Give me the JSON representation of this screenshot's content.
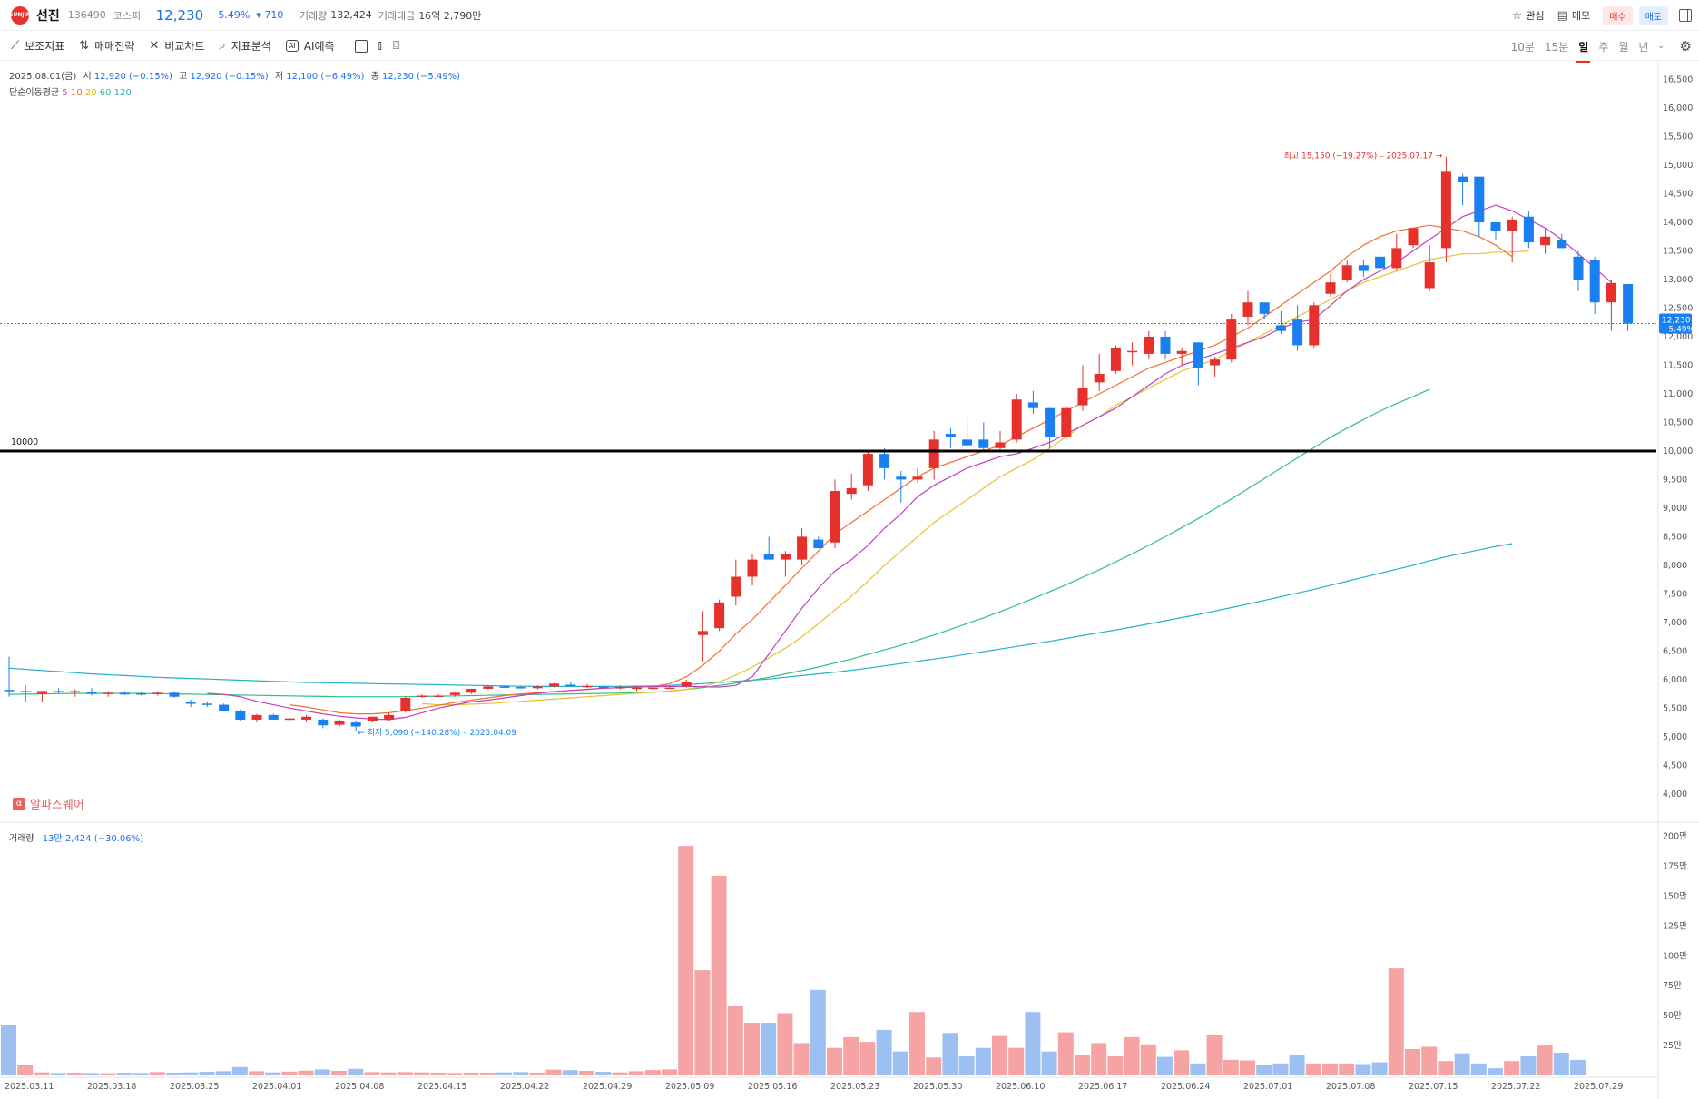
{
  "header": {
    "logo_text": "SUNJIN",
    "name": "선진",
    "code": "136490",
    "market": "코스피",
    "price": "12,230",
    "change_pct": "−5.49%",
    "change_amt": "▾ 710",
    "volume_label": "거래량",
    "volume": "132,424",
    "amount_label": "거래대금",
    "amount": "16억 2,790만",
    "watch_label": "관심",
    "memo_label": "메모",
    "buy_label": "매수",
    "sell_label": "매도"
  },
  "toolbar": {
    "indicators": "보조지표",
    "strategy": "매매전략",
    "compare": "비교차트",
    "analysis": "지표분석",
    "ai_badge": "AI",
    "ai_predict": "AI예측",
    "periods": [
      "10분",
      "15분",
      "일",
      "주",
      "월",
      "년"
    ],
    "active_period": "일"
  },
  "info": {
    "date": "2025.08.01(금)",
    "open_label": "시",
    "open": "12,920 (−0.15%)",
    "high_label": "고",
    "high": "12,920 (−0.15%)",
    "low_label": "저",
    "low": "12,100 (−6.49%)",
    "close_label": "종",
    "close": "12,230 (−5.49%)",
    "ma_label": "단순이동평균",
    "ma_periods": [
      "5",
      "10",
      "20",
      "60",
      "120"
    ],
    "volume_label": "거래량",
    "volume_value": "13만 2,424 (−30.06%)",
    "watermark": "알파스퀘어",
    "watermark_icon": "α"
  },
  "colors": {
    "up": "#e5302c",
    "down": "#1a7ff0",
    "vol_up": "#f5a3a3",
    "vol_down": "#9cc0f2",
    "vol_neutral": "#b5b5b5",
    "ma5": "#c040c0",
    "ma10": "#f07030",
    "ma20": "#e8c030",
    "ma60": "#2ec27a",
    "ma120": "#26b0c8"
  },
  "chart_data": {
    "type": "candlestick",
    "y_ticks": [
      4000,
      4500,
      5000,
      5500,
      6000,
      6500,
      7000,
      7500,
      8000,
      8500,
      9000,
      9500,
      10000,
      10500,
      11000,
      11500,
      12000,
      12500,
      13000,
      13500,
      14000,
      14500,
      15000,
      15500,
      16000,
      16500
    ],
    "ylim": [
      3600,
      16700
    ],
    "volume_ticks": [
      "25만",
      "50만",
      "75만",
      "100만",
      "125만",
      "150만",
      "175만",
      "200만"
    ],
    "volume_tick_values": [
      250000,
      500000,
      750000,
      1000000,
      1250000,
      1500000,
      1750000,
      2000000
    ],
    "volume_ylim": [
      0,
      2050000
    ],
    "x_tick_labels": [
      "2025.03.11",
      "2025.03.18",
      "2025.03.25",
      "2025.04.01",
      "2025.04.08",
      "2025.04.15",
      "2025.04.22",
      "2025.04.29",
      "2025.05.09",
      "2025.05.16",
      "2025.05.23",
      "2025.05.30",
      "2025.06.10",
      "2025.06.17",
      "2025.06.24",
      "2025.07.01",
      "2025.07.08",
      "2025.07.15",
      "2025.07.22",
      "2025.07.29"
    ],
    "x_tick_indices": [
      0,
      5,
      10,
      15,
      20,
      25,
      30,
      35,
      40,
      45,
      50,
      55,
      60,
      65,
      70,
      75,
      80,
      85,
      90,
      95
    ],
    "candles": [
      [
        5820,
        6400,
        5700,
        5800
      ],
      [
        5800,
        5900,
        5600,
        5800
      ],
      [
        5750,
        5800,
        5600,
        5800
      ],
      [
        5800,
        5850,
        5750,
        5780
      ],
      [
        5780,
        5830,
        5700,
        5800
      ],
      [
        5780,
        5850,
        5720,
        5750
      ],
      [
        5760,
        5800,
        5700,
        5770
      ],
      [
        5770,
        5800,
        5730,
        5740
      ],
      [
        5760,
        5790,
        5720,
        5740
      ],
      [
        5750,
        5800,
        5720,
        5770
      ],
      [
        5770,
        5800,
        5680,
        5700
      ],
      [
        5600,
        5650,
        5520,
        5580
      ],
      [
        5580,
        5620,
        5520,
        5560
      ],
      [
        5560,
        5580,
        5450,
        5450
      ],
      [
        5450,
        5480,
        5280,
        5300
      ],
      [
        5300,
        5400,
        5250,
        5380
      ],
      [
        5380,
        5400,
        5300,
        5300
      ],
      [
        5300,
        5350,
        5250,
        5320
      ],
      [
        5300,
        5380,
        5250,
        5350
      ],
      [
        5300,
        5320,
        5150,
        5200
      ],
      [
        5210,
        5300,
        5170,
        5270
      ],
      [
        5250,
        5280,
        5090,
        5180
      ],
      [
        5280,
        5350,
        5250,
        5350
      ],
      [
        5300,
        5420,
        5280,
        5380
      ],
      [
        5450,
        5700,
        5420,
        5680
      ],
      [
        5700,
        5740,
        5680,
        5720
      ],
      [
        5710,
        5740,
        5690,
        5720
      ],
      [
        5730,
        5780,
        5700,
        5770
      ],
      [
        5770,
        5840,
        5750,
        5840
      ],
      [
        5840,
        5900,
        5830,
        5880
      ],
      [
        5880,
        5900,
        5850,
        5860
      ],
      [
        5870,
        5890,
        5850,
        5860
      ],
      [
        5850,
        5900,
        5830,
        5880
      ],
      [
        5880,
        5940,
        5860,
        5930
      ],
      [
        5910,
        5950,
        5880,
        5900
      ],
      [
        5880,
        5920,
        5850,
        5890
      ],
      [
        5880,
        5910,
        5840,
        5860
      ],
      [
        5860,
        5900,
        5830,
        5870
      ],
      [
        5860,
        5890,
        5800,
        5860
      ],
      [
        5860,
        5880,
        5830,
        5860
      ],
      [
        5860,
        5890,
        5840,
        5860
      ],
      [
        5880,
        6000,
        5860,
        5960
      ],
      [
        6780,
        7200,
        6300,
        6850
      ],
      [
        6900,
        7400,
        6850,
        7350
      ],
      [
        7450,
        8100,
        7300,
        7800
      ],
      [
        7800,
        8200,
        7650,
        8100
      ],
      [
        8200,
        8500,
        8100,
        8100
      ],
      [
        8100,
        8250,
        7800,
        8200
      ],
      [
        8100,
        8650,
        8000,
        8500
      ],
      [
        8450,
        8500,
        8300,
        8300
      ],
      [
        8400,
        9500,
        8300,
        9300
      ],
      [
        9250,
        9600,
        9150,
        9350
      ],
      [
        9400,
        10000,
        9300,
        9950
      ],
      [
        9950,
        10050,
        9500,
        9700
      ],
      [
        9550,
        9650,
        9100,
        9500
      ],
      [
        9500,
        9700,
        9450,
        9550
      ],
      [
        9700,
        10350,
        9500,
        10200
      ],
      [
        10300,
        10400,
        10050,
        10250
      ],
      [
        10200,
        10600,
        10000,
        10100
      ],
      [
        10200,
        10500,
        10000,
        10050
      ],
      [
        10050,
        10350,
        10000,
        10150
      ],
      [
        10200,
        11000,
        10150,
        10900
      ],
      [
        10850,
        11050,
        10650,
        10750
      ],
      [
        10750,
        10750,
        10050,
        10250
      ],
      [
        10250,
        10800,
        10200,
        10750
      ],
      [
        10800,
        11500,
        10700,
        11100
      ],
      [
        11200,
        11700,
        11050,
        11350
      ],
      [
        11400,
        11850,
        11350,
        11800
      ],
      [
        11750,
        11900,
        11500,
        11750
      ],
      [
        11700,
        12100,
        11600,
        12000
      ],
      [
        12000,
        12100,
        11600,
        11700
      ],
      [
        11700,
        11800,
        11500,
        11750
      ],
      [
        11900,
        11900,
        11150,
        11450
      ],
      [
        11500,
        11650,
        11300,
        11600
      ],
      [
        11600,
        12400,
        11550,
        12300
      ],
      [
        12350,
        12800,
        12200,
        12600
      ],
      [
        12600,
        12600,
        12300,
        12400
      ],
      [
        12200,
        12450,
        12050,
        12100
      ],
      [
        12300,
        12550,
        11750,
        11850
      ],
      [
        11850,
        12600,
        11800,
        12550
      ],
      [
        12750,
        13100,
        12700,
        12950
      ],
      [
        13000,
        13350,
        12950,
        13250
      ],
      [
        13250,
        13350,
        13050,
        13150
      ],
      [
        13400,
        13500,
        13200,
        13200
      ],
      [
        13200,
        13800,
        13150,
        13550
      ],
      [
        13600,
        13900,
        13550,
        13900
      ],
      [
        12850,
        13600,
        12800,
        13300
      ],
      [
        13550,
        15150,
        13300,
        14900
      ],
      [
        14800,
        14850,
        14300,
        14700
      ],
      [
        14800,
        14800,
        13750,
        14000
      ],
      [
        14000,
        14000,
        13700,
        13850
      ],
      [
        13850,
        14100,
        13300,
        14050
      ],
      [
        14100,
        14200,
        13550,
        13650
      ],
      [
        13600,
        13900,
        13450,
        13750
      ],
      [
        13700,
        13800,
        13550,
        13550
      ],
      [
        13400,
        13500,
        12800,
        13000
      ],
      [
        13350,
        13400,
        12400,
        12600
      ],
      [
        12600,
        13000,
        12100,
        12940
      ],
      [
        12920,
        12920,
        12100,
        12230
      ]
    ],
    "volumes": [
      420000,
      90000,
      25000,
      20000,
      22000,
      20000,
      18000,
      22000,
      20000,
      28000,
      22000,
      25000,
      30000,
      35000,
      70000,
      35000,
      25000,
      32000,
      40000,
      50000,
      38000,
      55000,
      28000,
      25000,
      28000,
      25000,
      22000,
      20000,
      22000,
      22000,
      25000,
      28000,
      22000,
      48000,
      44000,
      38000,
      30000,
      25000,
      35000,
      45000,
      50000,
      1920000,
      880000,
      1670000,
      585000,
      440000,
      440000,
      520000,
      270000,
      715000,
      230000,
      320000,
      280000,
      380000,
      200000,
      530000,
      150000,
      355000,
      160000,
      230000,
      330000,
      230000,
      530000,
      200000,
      360000,
      170000,
      270000,
      160000,
      320000,
      260000,
      155000,
      210000,
      100000,
      340000,
      130000,
      125000,
      90000,
      100000,
      170000,
      100000,
      100000,
      100000,
      95000,
      110000,
      895000,
      220000,
      240000,
      120000,
      185000,
      100000,
      60000,
      120000,
      160000,
      250000,
      190000,
      130000
    ],
    "ma_lines": {
      "ma5": {
        "start": 12,
        "values": [
          5760,
          5740,
          5700,
          5620,
          5560,
          5500,
          5450,
          5400,
          5360,
          5330,
          5310,
          5300,
          5340,
          5420,
          5500,
          5560,
          5610,
          5640,
          5680,
          5720,
          5760,
          5790,
          5810,
          5830,
          5850,
          5860,
          5870,
          5875,
          5880,
          5880,
          5875,
          5870,
          5900,
          6050,
          6450,
          6850,
          7250,
          7600,
          7900,
          8100,
          8350,
          8650,
          8900,
          9200,
          9400,
          9550,
          9700,
          9800,
          9900,
          9950,
          10050,
          10150,
          10300,
          10450,
          10600,
          10750,
          10950,
          11150,
          11350,
          11500,
          11600,
          11700,
          11800,
          11900,
          12000,
          12150,
          12250,
          12300,
          12550,
          12800,
          13000,
          13150,
          13300,
          13500,
          13700,
          13900,
          14100,
          14200,
          14300,
          14200,
          14050,
          13900,
          13700,
          13450,
          13200,
          12950
        ]
      },
      "ma10": {
        "start": 17,
        "values": [
          5560,
          5520,
          5470,
          5420,
          5400,
          5400,
          5420,
          5460,
          5500,
          5550,
          5600,
          5640,
          5680,
          5720,
          5750,
          5770,
          5790,
          5810,
          5830,
          5850,
          5860,
          5870,
          5880,
          5930,
          6050,
          6250,
          6500,
          6800,
          7050,
          7350,
          7650,
          7950,
          8250,
          8550,
          8750,
          8950,
          9150,
          9350,
          9550,
          9700,
          9800,
          9900,
          10000,
          10100,
          10250,
          10400,
          10550,
          10700,
          10850,
          11000,
          11150,
          11300,
          11450,
          11550,
          11650,
          11750,
          11850,
          12000,
          12150,
          12350,
          12550,
          12750,
          12950,
          13150,
          13400,
          13600,
          13750,
          13850,
          13900,
          13950,
          13900,
          13850,
          13750,
          13600,
          13400
        ]
      },
      "ma20": {
        "start": 25,
        "values": [
          5580,
          5560,
          5560,
          5570,
          5580,
          5600,
          5620,
          5640,
          5660,
          5680,
          5700,
          5720,
          5740,
          5760,
          5780,
          5800,
          5830,
          5880,
          5960,
          6080,
          6220,
          6380,
          6550,
          6750,
          6980,
          7220,
          7460,
          7720,
          8000,
          8250,
          8500,
          8750,
          8950,
          9150,
          9350,
          9550,
          9700,
          9850,
          10050,
          10250,
          10450,
          10600,
          10800,
          10950,
          11100,
          11250,
          11400,
          11500,
          11600,
          11750,
          11900,
          12050,
          12200,
          12350,
          12500,
          12650,
          12800,
          12950,
          13050,
          13150,
          13250,
          13350,
          13400,
          13450,
          13450,
          13480,
          13480,
          13500
        ]
      },
      "ma60": {
        "start": 0,
        "values": [
          5740,
          5745,
          5750,
          5755,
          5758,
          5760,
          5760,
          5760,
          5758,
          5755,
          5750,
          5745,
          5740,
          5735,
          5730,
          5725,
          5720,
          5715,
          5710,
          5705,
          5700,
          5700,
          5700,
          5700,
          5700,
          5705,
          5710,
          5715,
          5720,
          5725,
          5730,
          5735,
          5740,
          5745,
          5750,
          5755,
          5760,
          5765,
          5770,
          5780,
          5800,
          5830,
          5860,
          5900,
          5940,
          5990,
          6040,
          6100,
          6160,
          6220,
          6290,
          6360,
          6440,
          6520,
          6600,
          6690,
          6780,
          6880,
          6980,
          7080,
          7190,
          7300,
          7420,
          7540,
          7660,
          7790,
          7920,
          8060,
          8200,
          8350,
          8500,
          8660,
          8820,
          8990,
          9160,
          9340,
          9520,
          9700,
          9880,
          10060,
          10240,
          10400,
          10550,
          10700,
          10830,
          10950,
          11080
        ]
      },
      "ma120": {
        "start": 0,
        "values": [
          6200,
          6180,
          6160,
          6140,
          6120,
          6100,
          6085,
          6070,
          6055,
          6040,
          6030,
          6020,
          6010,
          6000,
          5990,
          5980,
          5970,
          5960,
          5950,
          5945,
          5940,
          5935,
          5930,
          5925,
          5920,
          5915,
          5910,
          5905,
          5900,
          5895,
          5890,
          5885,
          5880,
          5880,
          5880,
          5880,
          5880,
          5880,
          5885,
          5890,
          5900,
          5915,
          5930,
          5950,
          5970,
          5990,
          6010,
          6040,
          6070,
          6100,
          6130,
          6165,
          6200,
          6240,
          6280,
          6320,
          6360,
          6400,
          6445,
          6490,
          6535,
          6580,
          6625,
          6670,
          6720,
          6770,
          6820,
          6870,
          6920,
          6975,
          7030,
          7085,
          7140,
          7200,
          7260,
          7320,
          7385,
          7450,
          7515,
          7580,
          7650,
          7720,
          7790,
          7860,
          7930,
          8000,
          8080,
          8150,
          8210,
          8270,
          8330,
          8380
        ]
      }
    },
    "horizontal_line": {
      "value": 10000,
      "label": "10000"
    },
    "current_price": {
      "value": 12230,
      "label": "12,230",
      "pct": "−5.49%"
    },
    "high_annotation": {
      "index": 87,
      "value": 15150,
      "text": "최고 15,150 (−19.27%) – 2025.07.17 →"
    },
    "low_annotation": {
      "index": 21,
      "value": 5090,
      "text": "← 최저 5,090 (+140.28%) – 2025.04.09"
    }
  }
}
